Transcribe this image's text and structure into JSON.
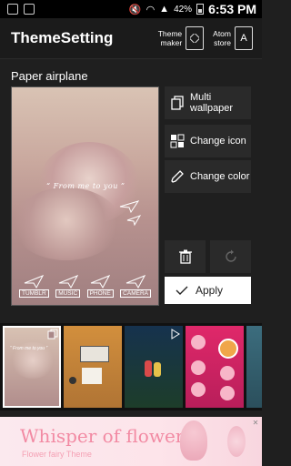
{
  "status_bar": {
    "battery_pct": "42%",
    "time": "6:53 PM"
  },
  "app_bar": {
    "title": "ThemeSetting",
    "theme_maker_label": "Theme\nmaker",
    "atom_store_label": "Atom\nstore",
    "atom_store_glyph": "A"
  },
  "preview": {
    "section_label": "Paper airplane",
    "quote": "“ From me to you ”",
    "dock_apps": [
      "TUMBLR",
      "MUSIC",
      "PHONE",
      "CAMERA"
    ]
  },
  "actions": {
    "multi_wallpaper": "Multi wallpaper",
    "change_icon": "Change icon",
    "change_color": "Change color",
    "apply": "Apply"
  },
  "thumbnail_strip": {
    "selected_quote": "“ From me to you ”"
  },
  "banner": {
    "title": "Whisper of flowers",
    "subtitle": "Flower fairy Theme"
  },
  "colors": {
    "accent": "#f28aa3",
    "surface": "#2a2a2a",
    "background": "#1f1f1f"
  }
}
